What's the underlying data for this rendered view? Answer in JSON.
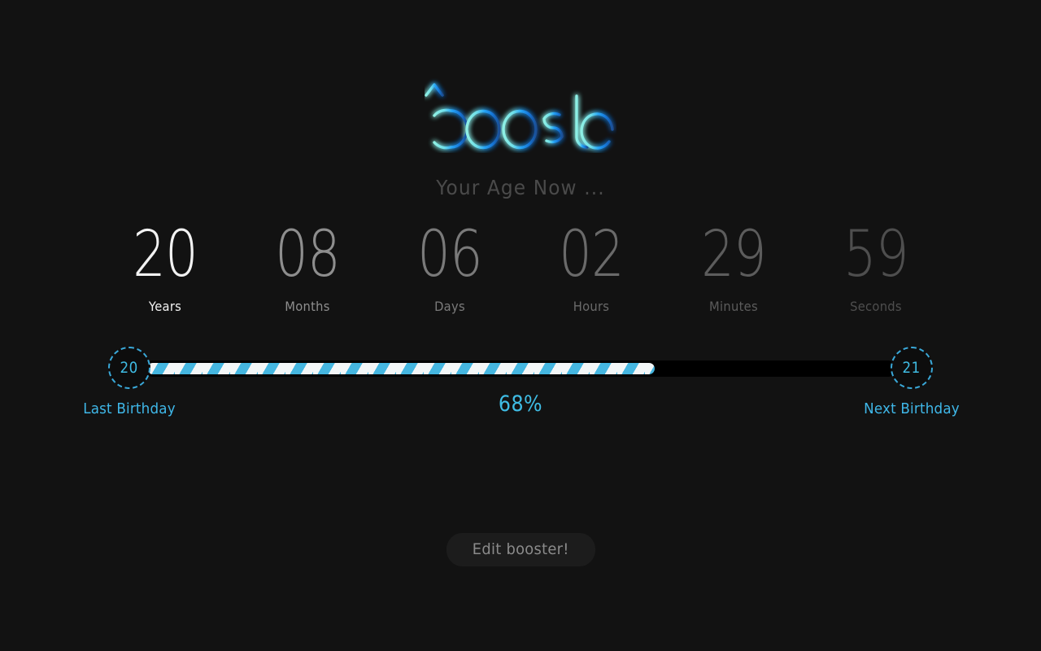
{
  "app": {
    "background_color": "#121212",
    "logo": {
      "text": "booster",
      "arrow_icon": "up-arrow-icon",
      "gradient_start": "#8ff0e4",
      "gradient_mid": "#1e90ff",
      "gradient_end": "#1558b0"
    },
    "subtitle": "Your Age Now ..."
  },
  "counters": [
    {
      "value": "20",
      "label": "Years",
      "color": "#f2f2f2"
    },
    {
      "value": "08",
      "label": "Months",
      "color": "#8e8e8e"
    },
    {
      "value": "06",
      "label": "Days",
      "color": "#7a7a7a"
    },
    {
      "value": "02",
      "label": "Hours",
      "color": "#6a6a6a"
    },
    {
      "value": "29",
      "label": "Minutes",
      "color": "#5c5c5c"
    },
    {
      "value": "59",
      "label": "Seconds",
      "color": "#4e4e4e"
    }
  ],
  "progress": {
    "percent_label": "68%",
    "percent_value": 68,
    "fill_color": "#45b6e0",
    "stripe_color": "#f2f6f7",
    "track_color": "#000000",
    "accent_color": "#3fbce4",
    "left_node": {
      "value": "20",
      "caption": "Last Birthday"
    },
    "right_node": {
      "value": "21",
      "caption": "Next Birthday"
    }
  },
  "actions": {
    "edit_label": "Edit booster!"
  }
}
